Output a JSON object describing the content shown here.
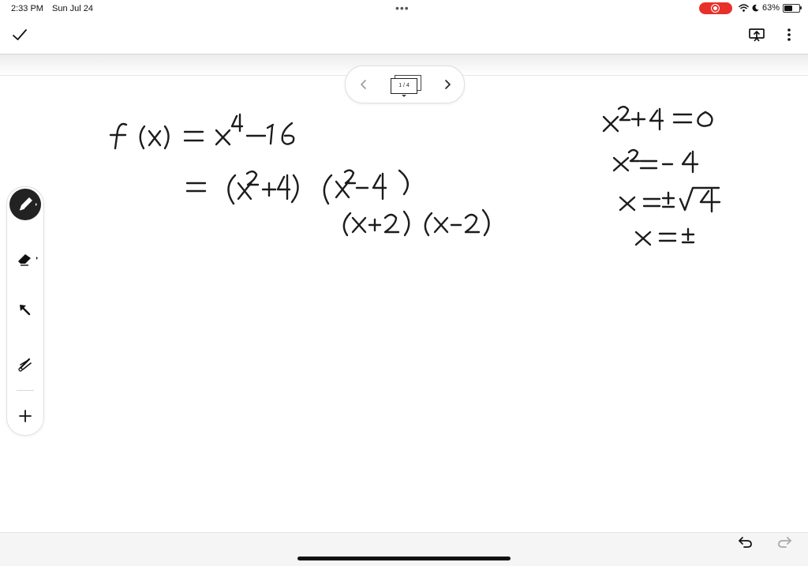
{
  "status_bar": {
    "time": "2:33 PM",
    "date": "Sun Jul 24",
    "battery_percent": "63%",
    "battery_level": 0.63,
    "icons": [
      "wifi-icon",
      "moon-icon",
      "battery-icon",
      "screen-record-icon"
    ]
  },
  "toolbar": {
    "icons": [
      "checkmark-icon",
      "present-icon",
      "more-icon"
    ]
  },
  "page_nav": {
    "page_label": "1 / 4",
    "icons": [
      "chevron-left-icon",
      "pages-icon",
      "chevron-right-icon"
    ]
  },
  "tools": {
    "items": [
      {
        "name": "pen",
        "icon": "pen-icon",
        "active": true
      },
      {
        "name": "eraser",
        "icon": "eraser-icon",
        "active": false
      },
      {
        "name": "select",
        "icon": "arrow-select-icon",
        "active": false
      },
      {
        "name": "laser",
        "icon": "laser-pointer-icon",
        "active": false
      },
      {
        "name": "add",
        "icon": "plus-icon",
        "active": false
      }
    ]
  },
  "handwriting": {
    "left": [
      "f(x) = x⁴ − 16",
      "= (x² + 4)(x² − 4)",
      "(x+2)(x−2)"
    ],
    "right": [
      "x² + 4 = 0",
      "x² = −4",
      "x = ±√−4",
      "x = ±"
    ]
  },
  "bottom_bar": {
    "icons": [
      "undo-icon",
      "redo-icon"
    ]
  }
}
